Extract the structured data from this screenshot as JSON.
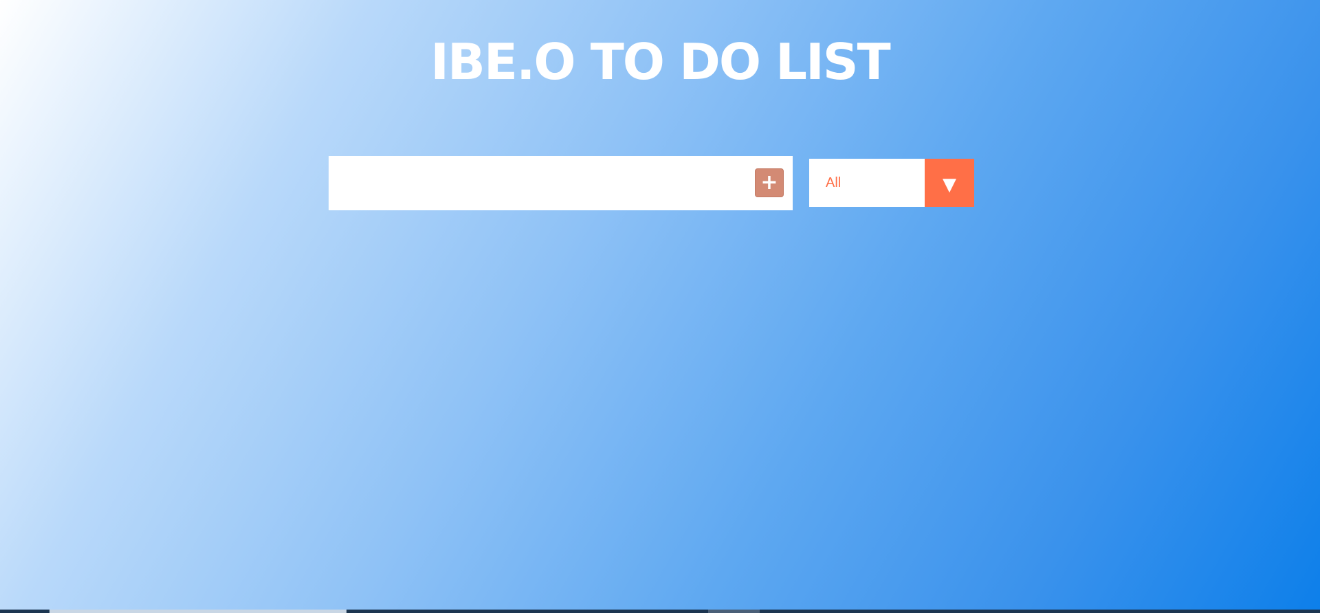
{
  "header": {
    "title": "IBE.O TO DO LIST"
  },
  "todo_form": {
    "input_value": "",
    "input_placeholder": "",
    "add_button_label": "+"
  },
  "filter": {
    "selected": "All",
    "arrow_glyph": "▼"
  },
  "icons": {
    "add": "plus-icon",
    "dropdown": "chevron-down-icon"
  },
  "colors": {
    "accent": "#ff6f47",
    "add_button": "#d38a74",
    "gradient_start": "#ffffff",
    "gradient_end": "#0d7fea",
    "title": "#ffffff"
  }
}
